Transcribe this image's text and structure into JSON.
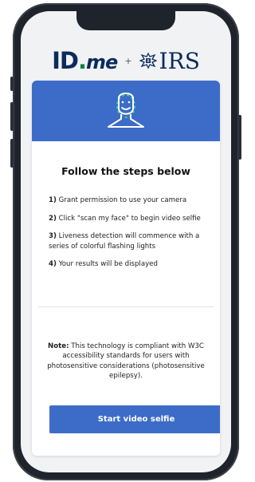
{
  "brand": {
    "idme_prefix": "ID",
    "idme_dot": ".",
    "idme_suffix": "me",
    "plus": "+",
    "irs": "IRS"
  },
  "icons": {
    "banner": "face-scan-icon",
    "irs_logo": "irs-eagle-icon"
  },
  "colors": {
    "accent": "#3c6cc7",
    "idme_navy": "#0b2b5c",
    "idme_green": "#08833d",
    "scan_dash": "#3fcf8e"
  },
  "main": {
    "title": "Follow the steps below",
    "steps": [
      {
        "num": "1)",
        "text": "Grant permission to use your camera"
      },
      {
        "num": "2)",
        "text": "Click \"scan my face\" to begin video selfie"
      },
      {
        "num": "3)",
        "text": "Liveness detection will commence with a series of colorful flashing lights"
      },
      {
        "num": "4)",
        "text": "Your results will be displayed"
      }
    ],
    "note_label": "Note:",
    "note_text": "This technology is compliant with W3C accessibility standards for users with photosensitive considerations (photosensitive epilepsy).",
    "cta_label": "Start video selfie"
  }
}
